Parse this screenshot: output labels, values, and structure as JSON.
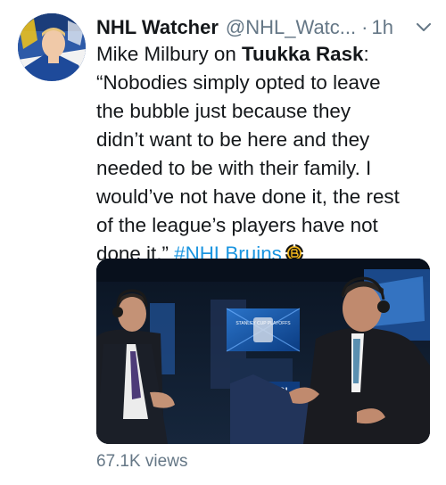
{
  "tweet": {
    "display_name": "NHL Watcher",
    "handle": "@NHL_Watc...",
    "separator": "·",
    "time": "1h",
    "text_lines": [
      [
        "Mike Milbury on ",
        "Tuukka Rask",
        ":"
      ],
      "“Nobodies simply opted to leave",
      "the bubble just because they",
      "didn’t want to be here and they",
      "needed to be with their family. I",
      "would’ve not have done it, the rest",
      "of the league’s players have not",
      [
        "done it.” ",
        "#NHLBruins"
      ]
    ],
    "media": {
      "screen_text": "STANLEY CUP PLAYOFFS",
      "desk_text": "FOX BL"
    },
    "views": "67.1K views"
  },
  "icons": {
    "avatar": "player-avatar",
    "chevron": "chevron-down-icon",
    "emoji": "bruins-logo-emoji"
  },
  "colors": {
    "text": "#14171a",
    "secondary": "#657786",
    "link": "#1b95e0"
  }
}
